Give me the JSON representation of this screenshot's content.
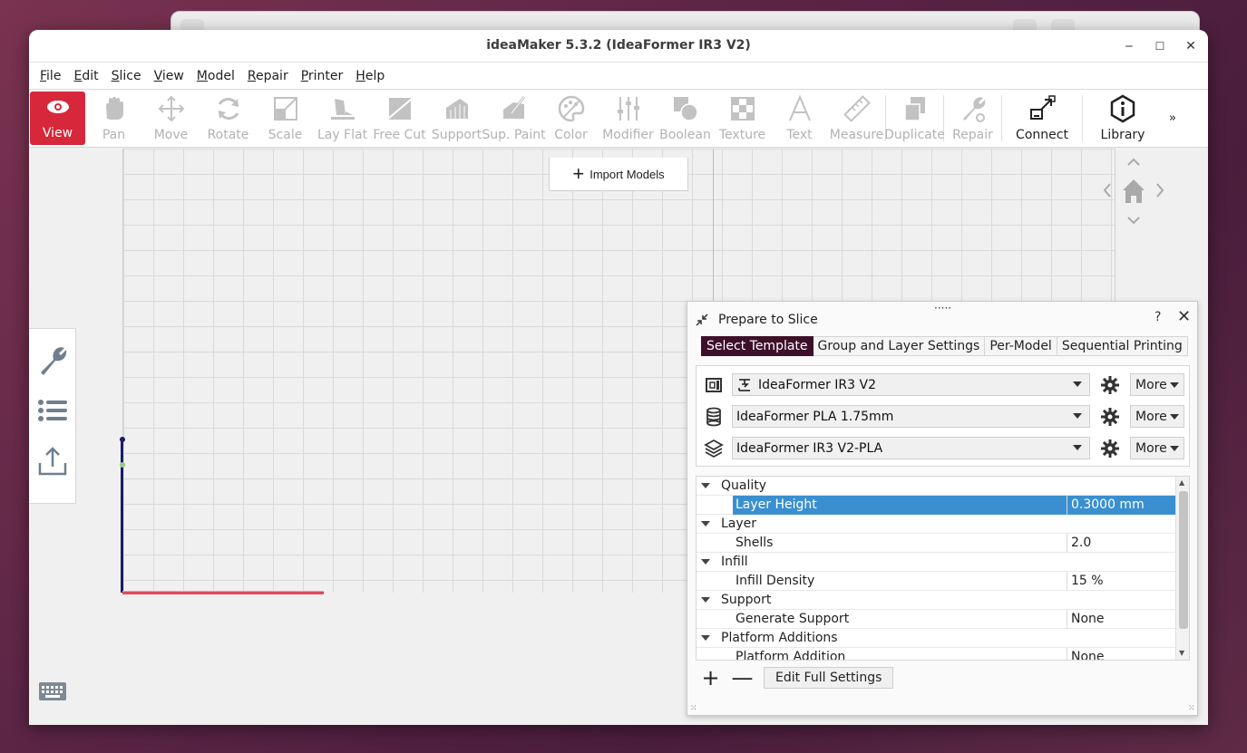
{
  "window": {
    "title": "ideaMaker 5.3.2 (IdeaFormer IR3 V2)",
    "background_title": "ideaMaker 5.3.2 (IdeaFormer IR3 V2)"
  },
  "window_controls": {
    "minimize": "‒",
    "maximize": "☐",
    "close": "✕"
  },
  "menu": [
    "File",
    "Edit",
    "Slice",
    "View",
    "Model",
    "Repair",
    "Printer",
    "Help"
  ],
  "toolbar": {
    "items": [
      {
        "label": "View",
        "icon": "eye-icon",
        "state": "active"
      },
      {
        "label": "Pan",
        "icon": "hand-icon",
        "state": "disabled"
      },
      {
        "label": "Move",
        "icon": "move-icon",
        "state": "disabled"
      },
      {
        "label": "Rotate",
        "icon": "rotate-icon",
        "state": "disabled"
      },
      {
        "label": "Scale",
        "icon": "scale-icon",
        "state": "disabled"
      },
      {
        "label": "Lay Flat",
        "icon": "lay-flat-icon",
        "state": "disabled"
      },
      {
        "label": "Free Cut",
        "icon": "free-cut-icon",
        "state": "disabled"
      },
      {
        "label": "Support",
        "icon": "support-icon",
        "state": "disabled"
      },
      {
        "label": "Sup. Paint",
        "icon": "support-paint-icon",
        "state": "disabled"
      },
      {
        "label": "Color",
        "icon": "palette-icon",
        "state": "disabled"
      },
      {
        "label": "Modifier",
        "icon": "sliders-icon",
        "state": "disabled"
      },
      {
        "label": "Boolean",
        "icon": "boolean-icon",
        "state": "disabled"
      },
      {
        "label": "Texture",
        "icon": "texture-icon",
        "state": "disabled"
      },
      {
        "label": "Text",
        "icon": "text-icon",
        "state": "disabled"
      },
      {
        "label": "Measure",
        "icon": "ruler-icon",
        "state": "disabled"
      },
      {
        "label": "Duplicate",
        "icon": "duplicate-icon",
        "state": "disabled"
      },
      {
        "label": "Repair",
        "icon": "wrench-icon",
        "state": "disabled"
      },
      {
        "label": "Connect",
        "icon": "connect-icon",
        "state": "enabled"
      },
      {
        "label": "Library",
        "icon": "info-icon",
        "state": "enabled"
      }
    ],
    "overflow": "»"
  },
  "viewport": {
    "import_button": "Import Models"
  },
  "dialog": {
    "title": "Prepare to Slice",
    "help": "?",
    "close": "✕",
    "grip": "·····",
    "tabs": [
      {
        "label": "Select Template",
        "selected": true
      },
      {
        "label": "Group and Layer Settings",
        "selected": false
      },
      {
        "label": "Per-Model",
        "selected": false
      },
      {
        "label": "Sequential Printing",
        "selected": false
      }
    ],
    "templates": [
      {
        "icon": "printer-icon",
        "value": "IdeaFormer IR3 V2",
        "more": "More"
      },
      {
        "icon": "filament-spool-icon",
        "value": "IdeaFormer PLA 1.75mm",
        "more": "More"
      },
      {
        "icon": "layers-icon",
        "value": "IdeaFormer IR3 V2-PLA",
        "more": "More"
      }
    ],
    "settings_tree": [
      {
        "type": "category",
        "label": "Quality"
      },
      {
        "type": "item",
        "label": "Layer Height",
        "value": "0.3000 mm",
        "selected": true
      },
      {
        "type": "category",
        "label": "Layer"
      },
      {
        "type": "item",
        "label": "Shells",
        "value": "2.0"
      },
      {
        "type": "category",
        "label": "Infill"
      },
      {
        "type": "item",
        "label": "Infill Density",
        "value": "15 %"
      },
      {
        "type": "category",
        "label": "Support"
      },
      {
        "type": "item",
        "label": "Generate Support",
        "value": "None"
      },
      {
        "type": "category",
        "label": "Platform Additions"
      },
      {
        "type": "item",
        "label": "Platform Addition",
        "value": "None"
      }
    ],
    "add_label": "+",
    "remove_label": "—",
    "edit_full_settings": "Edit Full Settings"
  },
  "colors": {
    "active_tool": "#d6283a",
    "selected_tab": "#3d0f2a",
    "selected_row": "#3a8fd0",
    "x_axis": "#e04a5a",
    "y_axis": "#1b1b6b"
  }
}
